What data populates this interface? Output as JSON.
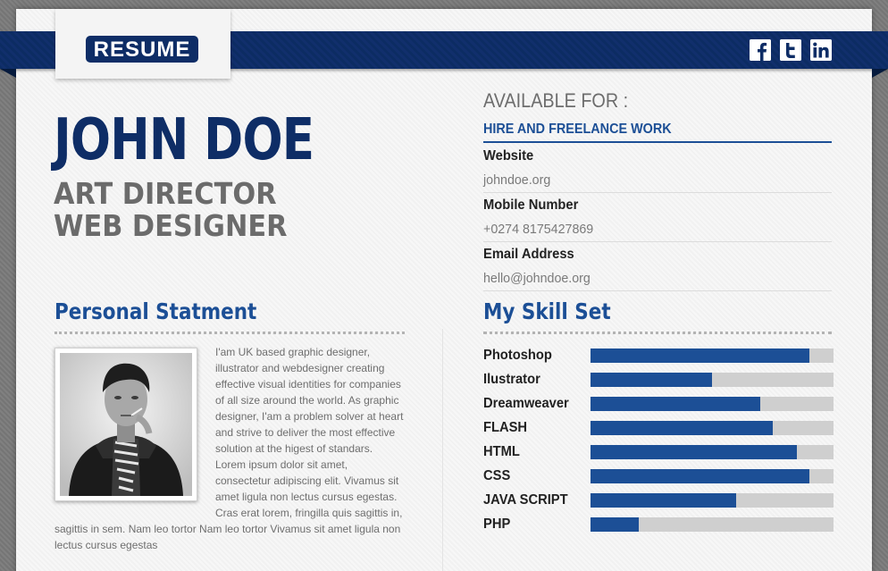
{
  "header": {
    "logo_text": "RESUME",
    "social_icons": [
      "facebook-icon",
      "twitter-icon",
      "linkedin-icon"
    ]
  },
  "profile": {
    "name": "JOHN DOE",
    "titles": [
      "ART DIRECTOR",
      "WEB DESIGNER"
    ]
  },
  "availability": {
    "heading": "AVAILABLE FOR :",
    "value": "HIRE AND FREELANCE WORK"
  },
  "contact": [
    {
      "label": "Website",
      "value": "johndoe.org"
    },
    {
      "label": "Mobile Number",
      "value": "+0274 8175427869"
    },
    {
      "label": "Email Address",
      "value": "hello@johndoe.org"
    }
  ],
  "statement": {
    "title": "Personal Statment",
    "text": "I'am UK based graphic designer, illustrator and webdesigner creating effective visual identities for companies of all size around the world. As graphic designer, I'am a problem solver at heart and strive to deliver the most effective solution at the higest of standars. Lorem ipsum dolor sit amet, consectetur adipiscing elit. Vivamus sit amet ligula non lectus cursus egestas. Cras erat lorem, fringilla quis sagittis in, sagittis in sem. Nam leo tortor Nam leo tortor Vivamus sit amet ligula non lectus cursus egestas"
  },
  "skills": {
    "title": "My Skill Set",
    "items": [
      {
        "name": "Photoshop",
        "level": 0.9
      },
      {
        "name": "Ilustrator",
        "level": 0.5
      },
      {
        "name": "Dreamweaver",
        "level": 0.7
      },
      {
        "name": "FLASH",
        "level": 0.75
      },
      {
        "name": "HTML",
        "level": 0.85
      },
      {
        "name": "CSS",
        "level": 0.9
      },
      {
        "name": "JAVA SCRIPT",
        "level": 0.6
      },
      {
        "name": "PHP",
        "level": 0.2
      }
    ]
  },
  "colors": {
    "navy": "#0e2d66",
    "accent_blue": "#1c4f96",
    "bar_track": "#cfcfcf"
  }
}
